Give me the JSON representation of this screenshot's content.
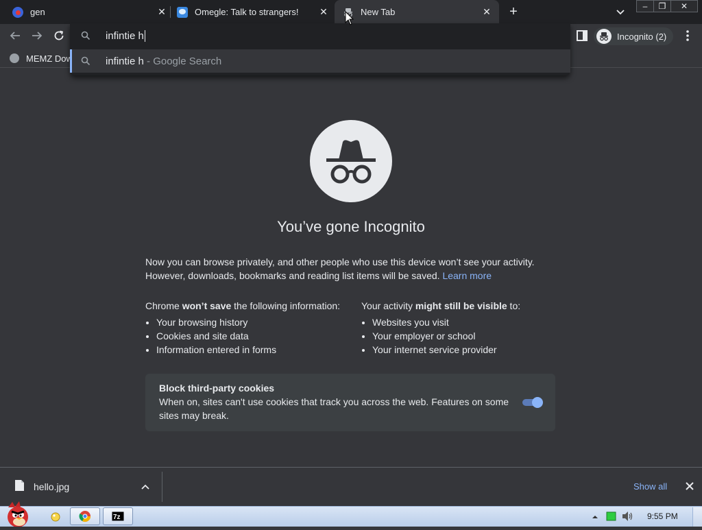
{
  "tabs": [
    {
      "title": "gen",
      "favicon": "red-circle-icon"
    },
    {
      "title": "Omegle: Talk to strangers!",
      "favicon": "omegle-icon"
    },
    {
      "title": "New Tab",
      "favicon": "incognito-icon",
      "active": true
    }
  ],
  "new_tab_symbol": "+",
  "tab_close_symbol": "✕",
  "window_controls": {
    "minimize": "–",
    "restore": "❐",
    "close": "✕"
  },
  "toolbar": {
    "profile_label": "Incognito (2)"
  },
  "bookmarks": [
    {
      "label": "MEMZ Dow"
    }
  ],
  "omnibox": {
    "input_value": "infintie h",
    "suggestion": {
      "query": "infintie h",
      "suffix": " - Google Search"
    }
  },
  "incognito_page": {
    "headline": "You’ve gone Incognito",
    "intro_line1": "Now you can browse privately, and other people who use this device won’t see your activity.",
    "intro_line2": "However, downloads, bookmarks and reading list items will be saved.",
    "learn_more": "Learn more",
    "left_heading_prefix": "Chrome ",
    "left_heading_bold": "won’t save",
    "left_heading_suffix": " the following information:",
    "left_items": [
      "Your browsing history",
      "Cookies and site data",
      "Information entered in forms"
    ],
    "right_heading_prefix": "Your activity ",
    "right_heading_bold": "might still be visible",
    "right_heading_suffix": " to:",
    "right_items": [
      "Websites you visit",
      "Your employer or school",
      "Your internet service provider"
    ],
    "cookie_title": "Block third-party cookies",
    "cookie_desc": "When on, sites can't use cookies that track you across the web. Features on some sites may break.",
    "cookie_toggle_on": true
  },
  "download_shelf": {
    "file_name": "hello.jpg",
    "show_all": "Show all"
  },
  "taskbar": {
    "time": "9:55 PM"
  },
  "colors": {
    "accent": "#8ab4f8",
    "background": "#35363a",
    "tabstrip": "#202124",
    "text": "#e8eaed"
  }
}
